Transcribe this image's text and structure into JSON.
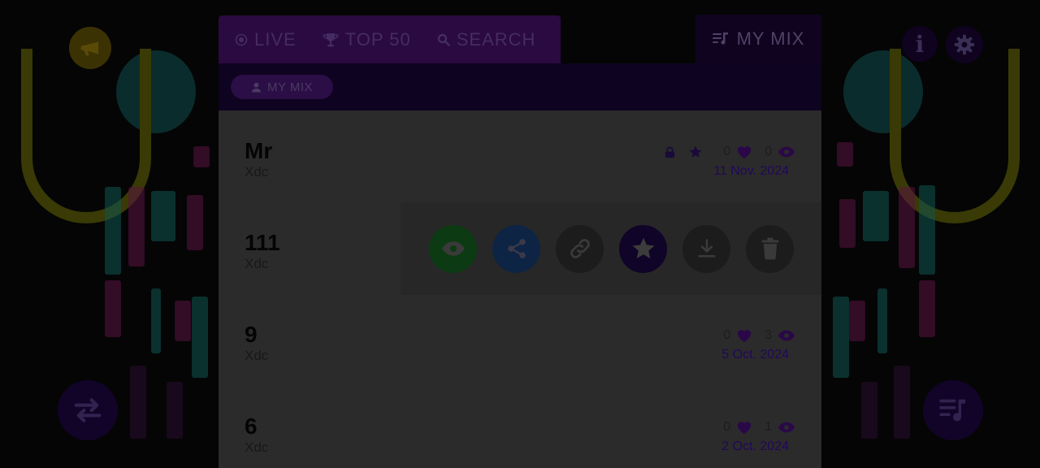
{
  "header": {
    "tabs": [
      {
        "label": "LIVE",
        "icon": "radio-target-icon"
      },
      {
        "label": "TOP 50",
        "icon": "trophy-icon"
      },
      {
        "label": "SEARCH",
        "icon": "search-icon"
      }
    ],
    "active_tab": {
      "label": "MY MIX",
      "icon": "playlist-icon"
    }
  },
  "subheader": {
    "chip": {
      "label": "MY MIX",
      "icon": "user-icon"
    }
  },
  "mixes": [
    {
      "title": "Mr",
      "artist": "Xdc",
      "likes": "0",
      "views": "0",
      "date": "11 Nov. 2024",
      "private": true,
      "featured": true
    },
    {
      "title": "111",
      "artist": "Xdc",
      "actions_open": true
    },
    {
      "title": "9",
      "artist": "Xdc",
      "likes": "0",
      "views": "3",
      "date": "5 Oct. 2024"
    },
    {
      "title": "6",
      "artist": "Xdc",
      "likes": "0",
      "views": "1",
      "date": "2 Oct. 2024"
    }
  ],
  "row_actions": [
    "view",
    "share",
    "copy-link",
    "feature",
    "download",
    "delete"
  ],
  "controls": {
    "info_label": "i"
  },
  "colors": {
    "accent_purple": "#7a1ec0",
    "dim_overlay": "rgba(0,0,0,0.78)",
    "view_green": "#1fa334",
    "share_blue": "#2563b0",
    "date_purple": "#4b18b5"
  }
}
